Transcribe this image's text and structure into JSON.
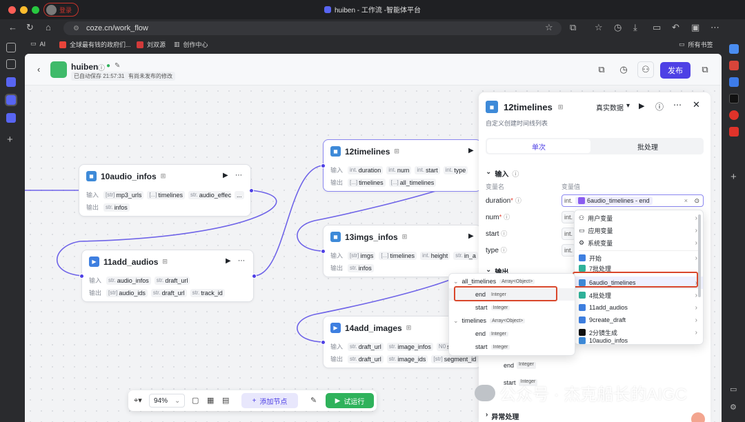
{
  "browser": {
    "login_label": "登录",
    "window_title": "huiben - 工作流 -智能体平台",
    "url": "coze.cn/work_flow",
    "bookmarks": [
      "AI",
      "全球最有钱的政府们...",
      "刘双源",
      "创作中心"
    ],
    "all_bookmarks": "所有书签"
  },
  "header": {
    "name": "huiben",
    "autosave": "已自动保存 21:57:31",
    "unpublished": "有尚未发布的修改",
    "publish_label": "发布"
  },
  "nodes": [
    {
      "id": "n10",
      "title": "10audio_infos",
      "inputs": [
        {
          "t": "[str]",
          "n": "mp3_urls"
        },
        {
          "t": "[...]",
          "n": "timelines"
        },
        {
          "t": "str.",
          "n": "audio_effec"
        }
      ],
      "more": "...",
      "outputs": [
        {
          "t": "str.",
          "n": "infos"
        }
      ]
    },
    {
      "id": "n11",
      "title": "11add_audios",
      "inputs": [
        {
          "t": "str.",
          "n": "audio_infos"
        },
        {
          "t": "str.",
          "n": "draft_url"
        }
      ],
      "outputs": [
        {
          "t": "[str]",
          "n": "audio_ids"
        },
        {
          "t": "str.",
          "n": "draft_url"
        },
        {
          "t": "str.",
          "n": "track_id"
        }
      ]
    },
    {
      "id": "n12",
      "title": "12timelines",
      "inputs": [
        {
          "t": "int.",
          "n": "duration"
        },
        {
          "t": "int.",
          "n": "num"
        },
        {
          "t": "int.",
          "n": "start"
        },
        {
          "t": "int.",
          "n": "type"
        }
      ],
      "outputs": [
        {
          "t": "[...]",
          "n": "timelines"
        },
        {
          "t": "[...]",
          "n": "all_timelines"
        }
      ]
    },
    {
      "id": "n13",
      "title": "13imgs_infos",
      "inputs": [
        {
          "t": "[str]",
          "n": "imgs"
        },
        {
          "t": "[...]",
          "n": "timelines"
        },
        {
          "t": "int.",
          "n": "height"
        },
        {
          "t": "str.",
          "n": "in_a"
        }
      ],
      "outputs": [
        {
          "t": "str.",
          "n": "infos"
        }
      ]
    },
    {
      "id": "n14",
      "title": "14add_images",
      "inputs": [
        {
          "t": "str.",
          "n": "draft_url"
        },
        {
          "t": "str.",
          "n": "image_infos"
        },
        {
          "t": "N0",
          "n": "scal"
        }
      ],
      "outputs": [
        {
          "t": "str.",
          "n": "draft_url"
        },
        {
          "t": "str.",
          "n": "image_ids"
        },
        {
          "t": "[str]",
          "n": "segment_id"
        }
      ]
    }
  ],
  "row_labels": {
    "input": "输入",
    "output": "输出"
  },
  "panel": {
    "title": "12timelines",
    "mode": "真实数据",
    "description": "自定义创建时间线列表",
    "tab_single": "单次",
    "tab_batch": "批处理",
    "section_input": "输入",
    "col_name": "变量名",
    "col_value": "变量值",
    "params": [
      "duration",
      "num",
      "start",
      "type"
    ],
    "duration_value": "6audio_timelines - end",
    "section_output": "输出",
    "output_rows": [
      "end",
      "start"
    ],
    "output_type": "Integer",
    "section_error": "异常处理"
  },
  "var_menu": {
    "groups": [
      "用户变量",
      "应用变量",
      "系统变量"
    ],
    "nodes": [
      "开始",
      "7批处理",
      "6audio_timelines",
      "4批处理",
      "11add_audios",
      "9create_draft",
      "2分镜生成",
      "10audio_infos"
    ]
  },
  "sub_menu": {
    "items": [
      {
        "name": "all_timelines",
        "type": "Array<Object>",
        "children": [
          {
            "name": "end",
            "type": "Integer"
          },
          {
            "name": "start",
            "type": "Integer"
          }
        ]
      },
      {
        "name": "timelines",
        "type": "Array<Object>",
        "children": [
          {
            "name": "end",
            "type": "Integer"
          },
          {
            "name": "start",
            "type": "Integer"
          }
        ]
      }
    ]
  },
  "toolbar": {
    "zoom": "94%",
    "add_node": "添加节点",
    "run": "试运行"
  },
  "watermark": "公众号 · 杰克船长的AIGC",
  "colors": {
    "accent": "#4e40e5",
    "highlight": "#d9472b",
    "run": "#2fb25b"
  }
}
